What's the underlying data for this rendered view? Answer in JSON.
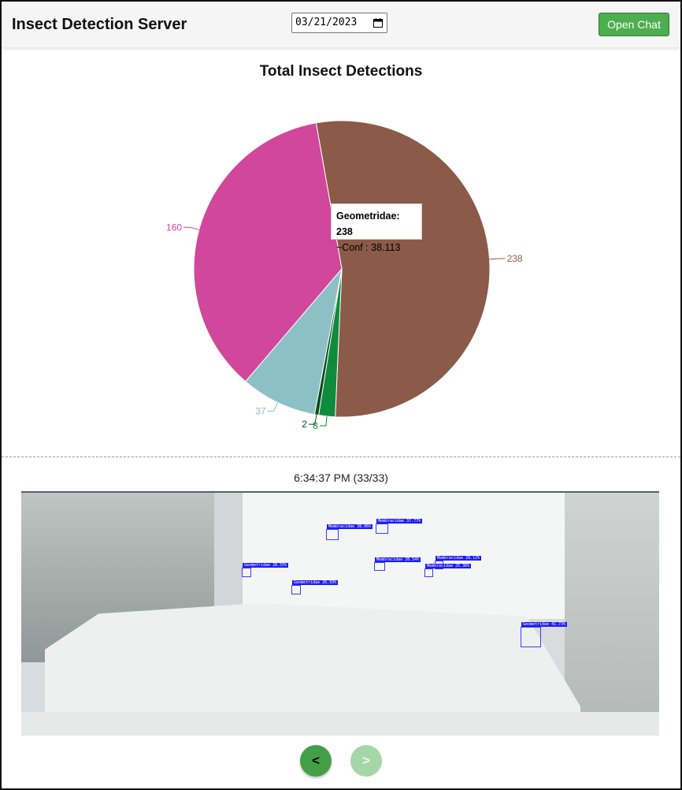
{
  "header": {
    "title": "Insect Detection Server",
    "date_value": "03/21/2023",
    "open_chat_label": "Open Chat"
  },
  "chart": {
    "title": "Total Insect Detections",
    "tooltip": {
      "heading": "Geometridae: 238",
      "detail": "~Conf : 38.113"
    }
  },
  "chart_data": {
    "type": "pie",
    "title": "Total Insect Detections",
    "start_angle_deg": 100,
    "series": [
      {
        "name": "Geometridae",
        "value": 238,
        "label": "238",
        "color": "#8b5a48"
      },
      {
        "name": "",
        "value": 8,
        "label": "8",
        "color": "#0e8c3b"
      },
      {
        "name": "",
        "value": 2,
        "label": "2",
        "color": "#0b4a1e"
      },
      {
        "name": "",
        "value": 37,
        "label": "37",
        "color": "#8cc0c6"
      },
      {
        "name": "",
        "value": 160,
        "label": "160",
        "color": "#d0479b"
      }
    ]
  },
  "viewer": {
    "timestamp": "6:34:37 PM (33/33)",
    "prev_label": "<",
    "next_label": ">"
  },
  "detections": [
    {
      "label": "Membracidae 38.06%"
    },
    {
      "label": "Membracidae 37.77%"
    },
    {
      "label": "Geometridae 28.55%"
    },
    {
      "label": "Membracidae 28.54%"
    },
    {
      "label": "Membracidae 28.12%"
    },
    {
      "label": "Membracidae 25.36%"
    },
    {
      "label": "Geometridae 26.93%"
    },
    {
      "label": "Geometridae 41.73%"
    }
  ],
  "colors": {
    "chat_button": "#4cae4c",
    "prev_button": "#43a047",
    "next_button_disabled": "#a5d6a7",
    "detection_box": "#1a1aff"
  }
}
